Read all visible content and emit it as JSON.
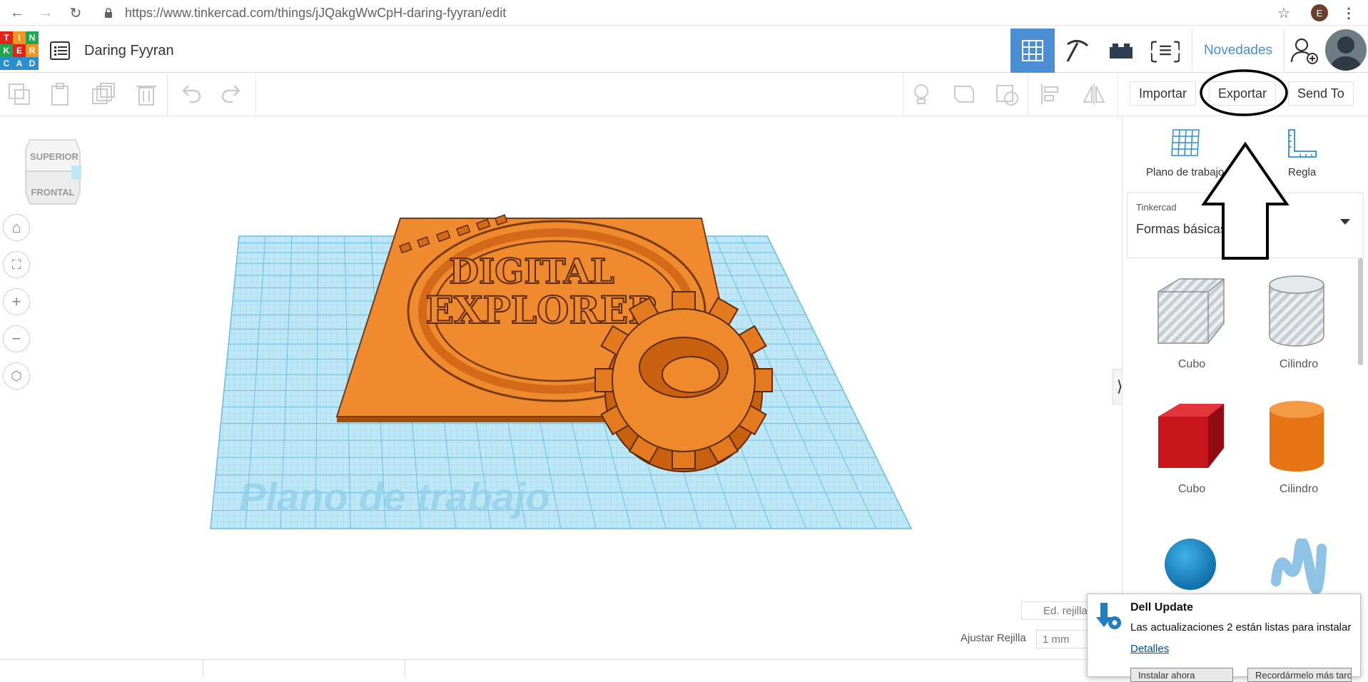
{
  "browser": {
    "url": "https://www.tinkercad.com/things/jJQakgWwCpH-daring-fyyran/edit",
    "profile_initial": "E"
  },
  "header": {
    "logo_letters": [
      "T",
      "I",
      "N",
      "K",
      "E",
      "R",
      "C",
      "A",
      "D"
    ],
    "logo_colors": [
      "#e2231a",
      "#f7941d",
      "#1fa84f",
      "#1fa84f",
      "#e2231a",
      "#f7941d",
      "#2b8fcf",
      "#2b8fcf",
      "#2b8fcf"
    ],
    "design_title": "Daring Fyyran",
    "novedades_label": "Novedades"
  },
  "toolbar": {
    "import_label": "Importar",
    "export_label": "Exportar",
    "sendto_label": "Send To"
  },
  "workspace": {
    "viewcube_top": "SUPERIOR",
    "viewcube_front": "FRONTAL",
    "workplane_watermark": "Plano de trabajo",
    "model_text_1": "DIGITAL",
    "model_text_2": "EXPLORER",
    "grid_edit_label": "Ed. rejilla",
    "snap_label": "Ajustar Rejilla",
    "snap_value": "1 mm",
    "colors": {
      "plate": "#ea7a1e",
      "grid": "#aee0f2",
      "grid_line": "#5fb8df"
    }
  },
  "panel": {
    "workplane_label": "Plano de trabajo",
    "ruler_label": "Regla",
    "library_source": "Tinkercad",
    "library_name": "Formas básicas",
    "shapes": [
      {
        "label": "Cubo"
      },
      {
        "label": "Cilindro"
      },
      {
        "label": "Cubo"
      },
      {
        "label": "Cilindro"
      }
    ]
  },
  "toast": {
    "title": "Dell Update",
    "message": "Las actualizaciones 2 están listas para instalar",
    "link": "Detalles",
    "install_label": "Instalar ahora",
    "later_label": "Recordármelo más tarde"
  }
}
